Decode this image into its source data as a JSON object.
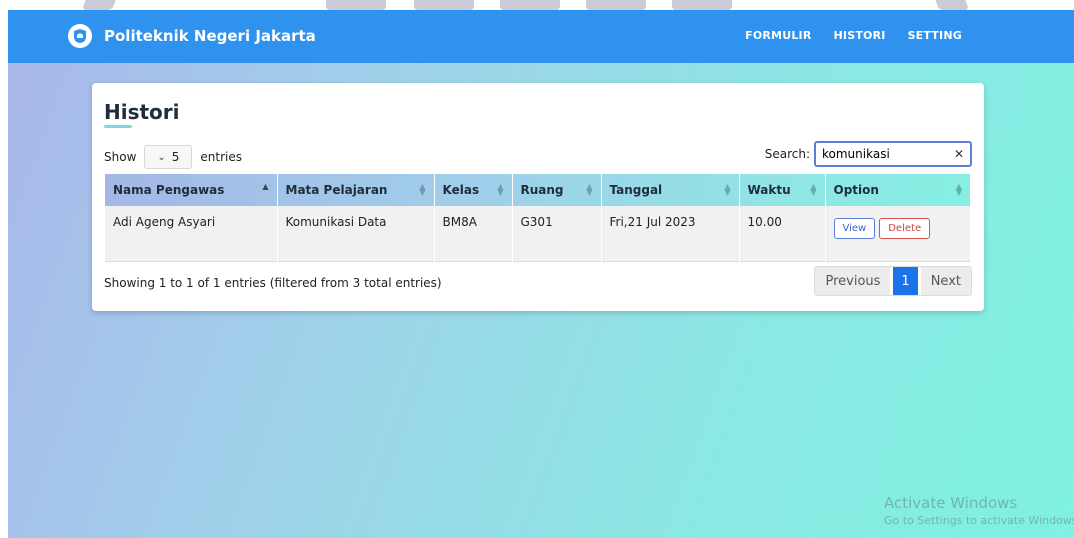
{
  "brand": {
    "name": "Politeknik Negeri Jakarta"
  },
  "nav": {
    "items": [
      {
        "label": "FORMULIR"
      },
      {
        "label": "HISTORI"
      },
      {
        "label": "SETTING"
      }
    ]
  },
  "page": {
    "title": "Histori"
  },
  "controls": {
    "show_label": "Show",
    "entries_value": "5",
    "entries_label": "entries",
    "search_label": "Search:",
    "search_value": "komunikasi"
  },
  "table": {
    "headers": [
      "Nama Pengawas",
      "Mata Pelajaran",
      "Kelas",
      "Ruang",
      "Tanggal",
      "Waktu",
      "Option"
    ],
    "rows": [
      {
        "nama_pengawas": "Adi Ageng Asyari",
        "mata_pelajaran": "Komunikasi Data",
        "kelas": "BM8A",
        "ruang": "G301",
        "tanggal": "Fri,21 Jul 2023",
        "waktu": "10.00",
        "view_label": "View",
        "delete_label": "Delete"
      }
    ]
  },
  "footer": {
    "info": "Showing 1 to 1 of 1 entries (filtered from 3 total entries)",
    "pagination": {
      "previous": "Previous",
      "current": "1",
      "next": "Next"
    }
  },
  "watermark": {
    "line1": "Activate Windows",
    "line2": "Go to Settings to activate Windows."
  },
  "colors": {
    "navbar": "#2e92ee",
    "accent": "#1a73e8"
  }
}
